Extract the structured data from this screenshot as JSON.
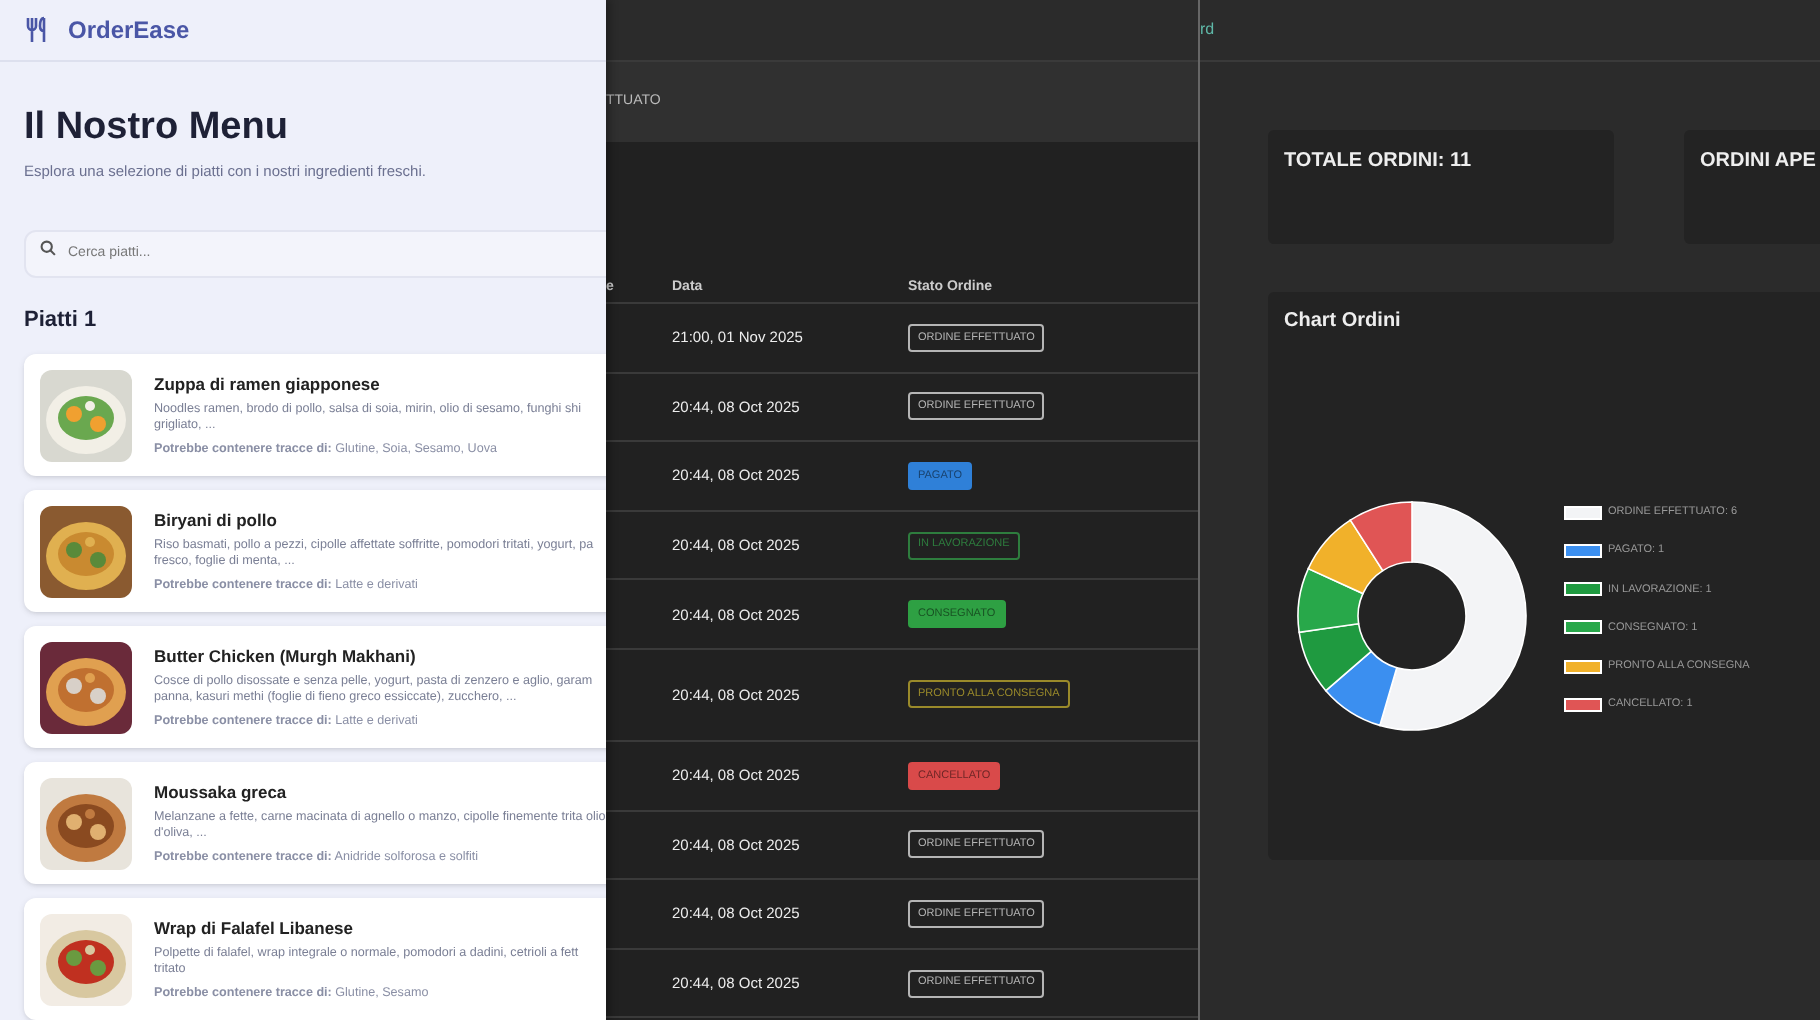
{
  "menu_app": {
    "brand": "OrderEase",
    "title": "Il Nostro Menu",
    "subtitle": "Esplora una selezione di piatti con i nostri ingredienti freschi.",
    "search": {
      "placeholder": "Cerca piatti..."
    },
    "section_title": "Piatti 1",
    "dishes": [
      {
        "name": "Zuppa di ramen giapponese",
        "description": "Noodles ramen, brodo di pollo, salsa di soia, mirin, olio di sesamo, funghi shi grigliato, ...",
        "allergens": "**Potrebbe contenere tracce di:** Glutine, Soia, Sesamo, Uova"
      },
      {
        "name": "Biryani di pollo",
        "description": "Riso basmati, pollo a pezzi, cipolle affettate soffritte, pomodori tritati, yogurt, pa fresco, foglie di menta, ...",
        "allergens": "**Potrebbe contenere tracce di:** Latte e derivati"
      },
      {
        "name": "Butter Chicken (Murgh Makhani)",
        "description": "Cosce di pollo disossate e senza pelle, yogurt, pasta di zenzero e aglio, garam panna, kasuri methi (foglie di fieno greco essiccate), zucchero, ...",
        "allergens": "**Potrebbe contenere tracce di:** Latte e derivati"
      },
      {
        "name": "Moussaka greca",
        "description": "Melanzane a fette, carne macinata di agnello o manzo, cipolle finemente trita olio d'oliva, ...",
        "allergens": "**Potrebbe contenere tracce di:** Anidride solforosa e solfiti"
      },
      {
        "name": "Wrap di Falafel Libanese",
        "description": "Polpette di falafel, wrap integrale o normale, pomodori a dadini, cetrioli a fett tritato",
        "allergens": "**Potrebbe contenere tracce di:** Glutine, Sesamo"
      }
    ]
  },
  "orders_panel": {
    "tab": "TTUATO",
    "table": {
      "columns": [
        "e",
        "Data",
        "Stato Ordine"
      ],
      "rows": [
        {
          "date": "21:00, 01 Nov 2025",
          "status": {
            "text": "ORDINE EFFETTUATO",
            "kind": "outline",
            "color": "#b5b5b5"
          }
        },
        {
          "date": "20:44, 08 Oct 2025",
          "status": {
            "text": "ORDINE EFFETTUATO",
            "kind": "outline",
            "color": "#b5b5b5"
          }
        },
        {
          "date": "20:44, 08 Oct 2025",
          "status": {
            "text": "PAGATO",
            "kind": "filled",
            "color": "#2f80d8"
          }
        },
        {
          "date": "20:44, 08 Oct 2025",
          "status": {
            "text": "IN LAVORAZIONE",
            "kind": "outline",
            "color": "#2e7d3e"
          }
        },
        {
          "date": "20:44, 08 Oct 2025",
          "status": {
            "text": "CONSEGNATO",
            "kind": "filled",
            "color": "#2ea043"
          }
        },
        {
          "date": "20:44, 08 Oct 2025",
          "status": {
            "text": "PRONTO ALLA CONSEGNA",
            "kind": "outline",
            "color": "#9a8a2a"
          }
        },
        {
          "date": "20:44, 08 Oct 2025",
          "status": {
            "text": "CANCELLATO",
            "kind": "filled",
            "color": "#d94a4a"
          }
        },
        {
          "date": "20:44, 08 Oct 2025",
          "status": {
            "text": "ORDINE EFFETTUATO",
            "kind": "outline",
            "color": "#b5b5b5"
          }
        },
        {
          "date": "20:44, 08 Oct 2025",
          "status": {
            "text": "ORDINE EFFETTUATO",
            "kind": "outline",
            "color": "#b5b5b5"
          }
        },
        {
          "date": "20:44, 08 Oct 2025",
          "status": {
            "text": "ORDINE EFFETTUATO",
            "kind": "outline",
            "color": "#b5b5b5"
          }
        }
      ]
    }
  },
  "dashboard": {
    "nav_text": "rd",
    "stat_cards": [
      "TOTALE ORDINI: 11",
      "ORDINI APE"
    ],
    "chart_card": {
      "chart_data": {
        "type": "donut",
        "legend": true,
        "title": "Chart Ordini",
        "categories": [
          "ORDINE EFFETTUATO: 6",
          "PAGATO: 1",
          "IN LAVORAZIONE: 1",
          "CONSEGNATO: 1",
          "PRONTO ALLA CONSEGNA",
          "CANCELLATO: 1"
        ],
        "values": [
          6,
          1,
          1,
          1,
          1,
          1
        ],
        "colors": [
          "#f3f4f6",
          "#3b8ff0",
          "#1f9a40",
          "#28a84a",
          "#f1b12a",
          "#e05555"
        ]
      }
    }
  }
}
